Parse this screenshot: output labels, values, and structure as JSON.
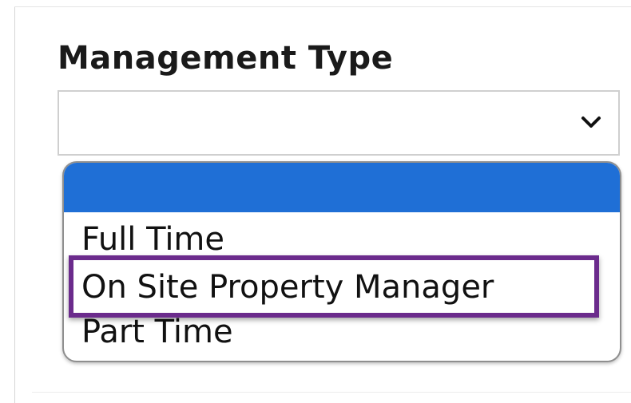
{
  "field": {
    "label": "Management Type",
    "selected_value": ""
  },
  "dropdown": {
    "options": [
      {
        "label": ""
      },
      {
        "label": "Full Time"
      },
      {
        "label": "On Site Property Manager"
      },
      {
        "label": "Part Time"
      }
    ],
    "highlighted_index": 0,
    "annotated_index": 2
  },
  "icons": {
    "select_arrow": "chevron-down-icon"
  },
  "colors": {
    "highlight_option_bg": "#1f6fd6",
    "annotation_border": "#6b2b8c"
  }
}
